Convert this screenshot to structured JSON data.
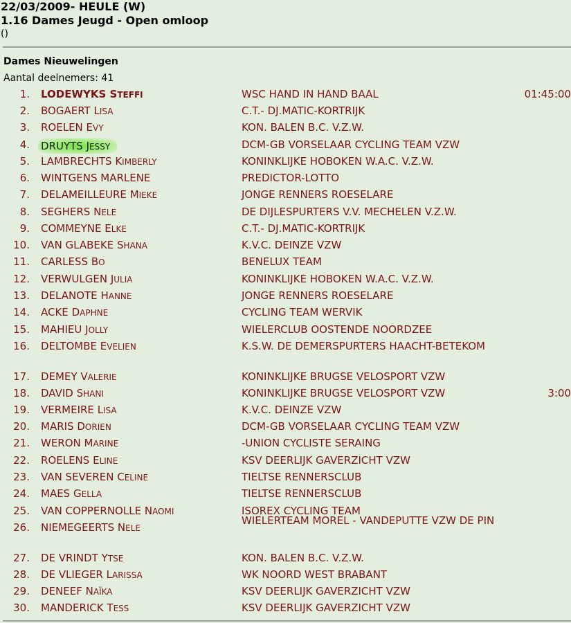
{
  "header": {
    "line1": "22/03/2009- HEULE (W)",
    "line2": "1.16 Dames Jeugd - Open omloop",
    "line3": "()"
  },
  "category": {
    "title": "Dames Nieuwelingen",
    "participants": "Aantal deelnemers: 41"
  },
  "highlighted_rider_position": "4.",
  "results": [
    {
      "pos": "1.",
      "first": "LODEWYKS",
      "second": "Steffi",
      "club": "WSC HAND IN HAND BAAL",
      "time": "01:45:00"
    },
    {
      "pos": "2.",
      "first": "BOGAERT",
      "second": "Lisa",
      "club": "C.T.- DJ.MATIC-KORTRIJK",
      "time": ""
    },
    {
      "pos": "3.",
      "first": "ROELEN",
      "second": "Evy",
      "club": "KON. BALEN B.C. V.Z.W.",
      "time": ""
    },
    {
      "pos": "4.",
      "first": "DRUYTS",
      "second": "Jessy",
      "club": "DCM-GB VORSELAAR CYCLING TEAM VZW",
      "time": ""
    },
    {
      "pos": "5.",
      "first": "LAMBRECHTS",
      "second": "Kimberly",
      "club": "KONINKLIJKE HOBOKEN W.A.C. V.Z.W.",
      "time": ""
    },
    {
      "pos": "6.",
      "first": "WINTGENS MARLENE",
      "second": "",
      "club": "PREDICTOR-LOTTO",
      "time": ""
    },
    {
      "pos": "7.",
      "first": "DELAMEILLEURE",
      "second": "Mieke",
      "club": "JONGE RENNERS ROESELARE",
      "time": ""
    },
    {
      "pos": "8.",
      "first": "SEGHERS",
      "second": "Nele",
      "club": "DE DIJLESPURTERS V.V. MECHELEN V.Z.W.",
      "time": ""
    },
    {
      "pos": "9.",
      "first": "COMMEYNE",
      "second": "Elke",
      "club": "C.T.- DJ.MATIC-KORTRIJK",
      "time": ""
    },
    {
      "pos": "10.",
      "first": "VAN GLABEKE",
      "second": "Shana",
      "club": "K.V.C. DEINZE VZW",
      "time": ""
    },
    {
      "pos": "11.",
      "first": "CARLESS",
      "second": "Bo",
      "club": "BENELUX TEAM",
      "time": ""
    },
    {
      "pos": "12.",
      "first": "VERWULGEN",
      "second": "Julia",
      "club": "KONINKLIJKE HOBOKEN W.A.C. V.Z.W.",
      "time": ""
    },
    {
      "pos": "13.",
      "first": "DELANOTE",
      "second": "Hanne",
      "club": "JONGE RENNERS ROESELARE",
      "time": ""
    },
    {
      "pos": "14.",
      "first": "ACKE",
      "second": "Daphne",
      "club": "CYCLING TEAM WERVIK",
      "time": ""
    },
    {
      "pos": "15.",
      "first": "MAHIEU",
      "second": "Jolly",
      "club": "WIELERCLUB OOSTENDE NOORDZEE",
      "time": ""
    },
    {
      "pos": "16.",
      "first": "DELTOMBE",
      "second": "Evelien",
      "club": "K.S.W. DE DEMERSPURTERS HAACHT-BETEKOM",
      "time": ""
    },
    {
      "pos": "17.",
      "first": "DEMEY",
      "second": "Valerie",
      "club": "KONINKLIJKE BRUGSE VELOSPORT VZW",
      "time": ""
    },
    {
      "pos": "18.",
      "first": "DAVID",
      "second": "Shani",
      "club": "KONINKLIJKE BRUGSE VELOSPORT VZW",
      "time": "3:00"
    },
    {
      "pos": "19.",
      "first": "VERMEIRE",
      "second": "Lisa",
      "club": "K.V.C. DEINZE VZW",
      "time": ""
    },
    {
      "pos": "20.",
      "first": "MARIS",
      "second": "Dorien",
      "club": "DCM-GB VORSELAAR CYCLING TEAM VZW",
      "time": ""
    },
    {
      "pos": "21.",
      "first": "WERON",
      "second": "Marine",
      "club": "-UNION CYCLISTE SERAING",
      "time": ""
    },
    {
      "pos": "22.",
      "first": "ROELENS",
      "second": "Eline",
      "club": "KSV DEERLIJK GAVERZICHT VZW",
      "time": ""
    },
    {
      "pos": "23.",
      "first": "VAN SEVEREN",
      "second": "Celine",
      "club": "TIELTSE RENNERSCLUB",
      "time": ""
    },
    {
      "pos": "24.",
      "first": "MAES",
      "second": "Gella",
      "club": "TIELTSE RENNERSCLUB",
      "time": ""
    },
    {
      "pos": "25.",
      "first": "VAN COPPERNOLLE",
      "second": "Naomi",
      "club": "ISOREX CYCLING TEAM",
      "time": ""
    },
    {
      "pos": "26.",
      "first": "NIEMEGEERTS",
      "second": "Nele",
      "club": "WIELERTEAM MOREL - VANDEPUTTE VZW DE PIN",
      "time": ""
    },
    {
      "pos": "27.",
      "first": "DE VRINDT",
      "second": "Ytse",
      "club": "KON. BALEN B.C. V.Z.W.",
      "time": ""
    },
    {
      "pos": "28.",
      "first": "DE VLIEGER",
      "second": "Larissa",
      "club": "WK NOORD WEST BRABANT",
      "time": ""
    },
    {
      "pos": "29.",
      "first": "DENEEF",
      "second": "Naïka",
      "club": "KSV DEERLIJK GAVERZICHT VZW",
      "time": ""
    },
    {
      "pos": "30.",
      "first": "MANDERICK",
      "second": "Tess",
      "club": "KSV DEERLIJK GAVERZICHT VZW",
      "time": ""
    }
  ],
  "colors": {
    "background": "#e3eedf",
    "text_accent": "#7a1418",
    "highlight": "#78e146"
  }
}
